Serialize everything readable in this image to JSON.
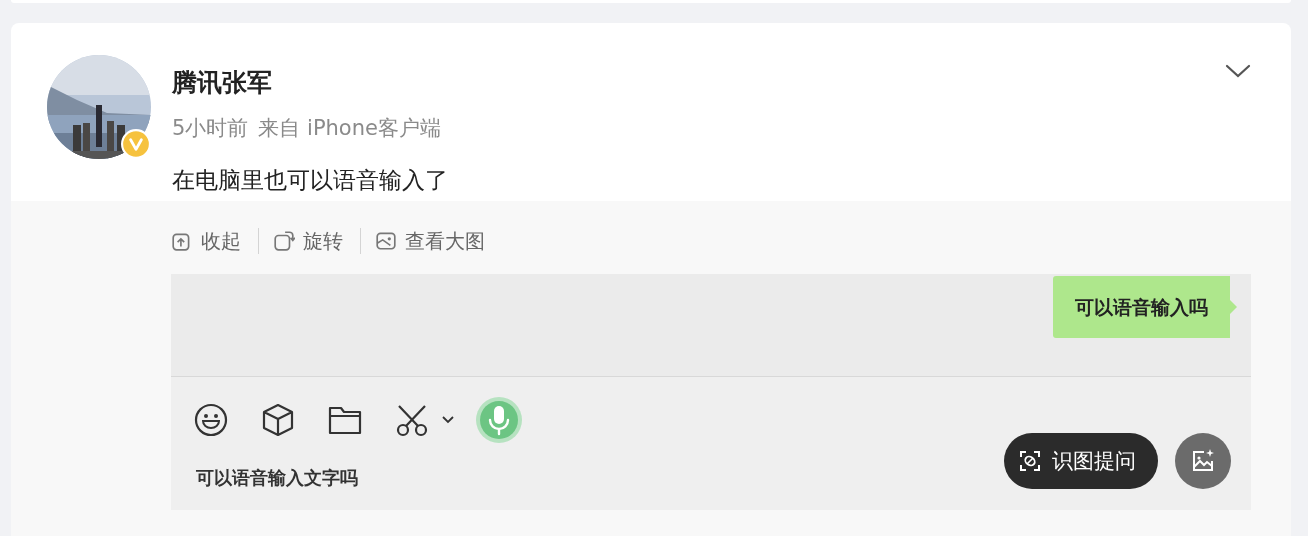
{
  "post": {
    "author": "腾讯张军",
    "verified": true,
    "time": "5小时前",
    "source": "来自 iPhone客户端",
    "text": "在电脑里也可以语音输入了",
    "image_actions": [
      {
        "kind": "collapse",
        "label": "收起"
      },
      {
        "kind": "rotate",
        "label": "旋转"
      },
      {
        "kind": "view",
        "label": "查看大图"
      }
    ],
    "screenshot": {
      "messages": [
        {
          "text": "可以语音输入吗"
        }
      ],
      "input_value": "可以语音输入文字吗"
    },
    "overlay": {
      "ask_label": "识图提问"
    }
  }
}
